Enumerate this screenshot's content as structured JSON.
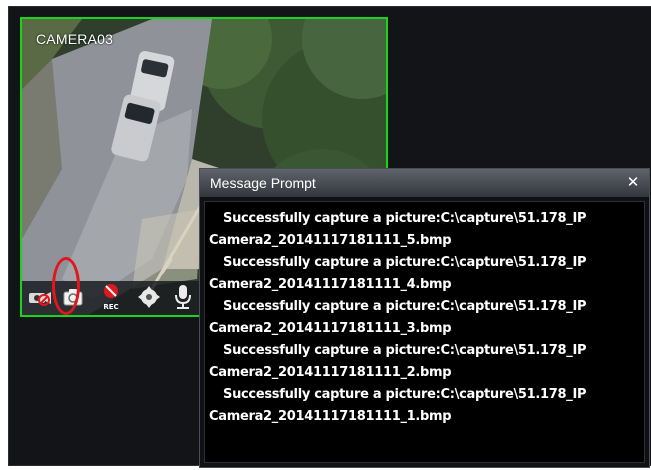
{
  "camera": {
    "label": "CAMERA03",
    "border_color": "#19d419",
    "toolbar": {
      "rec_label": "REC"
    }
  },
  "dialog": {
    "title": "Message Prompt",
    "close_glyph": "✕",
    "messages": [
      {
        "line1": "Successfully capture a picture:C:\\capture\\51.178_IP",
        "line2": "Camera2_20141117181111_5.bmp"
      },
      {
        "line1": "Successfully capture a picture:C:\\capture\\51.178_IP",
        "line2": "Camera2_20141117181111_4.bmp"
      },
      {
        "line1": "Successfully capture a picture:C:\\capture\\51.178_IP",
        "line2": "Camera2_20141117181111_3.bmp"
      },
      {
        "line1": "Successfully capture a picture:C:\\capture\\51.178_IP",
        "line2": "Camera2_20141117181111_2.bmp"
      },
      {
        "line1": "Successfully capture a picture:C:\\capture\\51.178_IP",
        "line2": "Camera2_20141117181111_1.bmp"
      }
    ]
  },
  "colors": {
    "highlight_ring": "#e0171b",
    "viewer_background": "#121418"
  }
}
